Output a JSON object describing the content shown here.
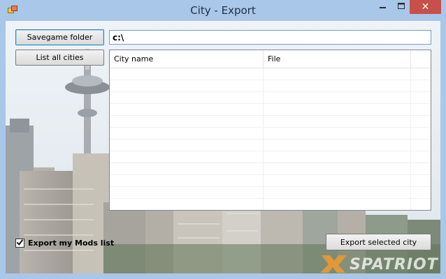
{
  "window": {
    "title": "City - Export",
    "controls": {
      "minimize_icon": "minimize-icon",
      "maximize_icon": "maximize-icon",
      "close_icon": "close-icon",
      "close_glyph": "✕"
    }
  },
  "toolbar": {
    "savegame_label": "Savegame folder",
    "list_label": "List all cities"
  },
  "path_field": {
    "value": "c:\\"
  },
  "city_list": {
    "columns": [
      "City name",
      "File"
    ],
    "rows": []
  },
  "options": {
    "export_mods_label": "Export my Mods list",
    "export_mods_checked": true
  },
  "actions": {
    "export_label": "Export selected city"
  },
  "colors": {
    "titlebar": "#a9c7e8",
    "close_button": "#c7504a",
    "focus_border": "#3c7fb1"
  }
}
